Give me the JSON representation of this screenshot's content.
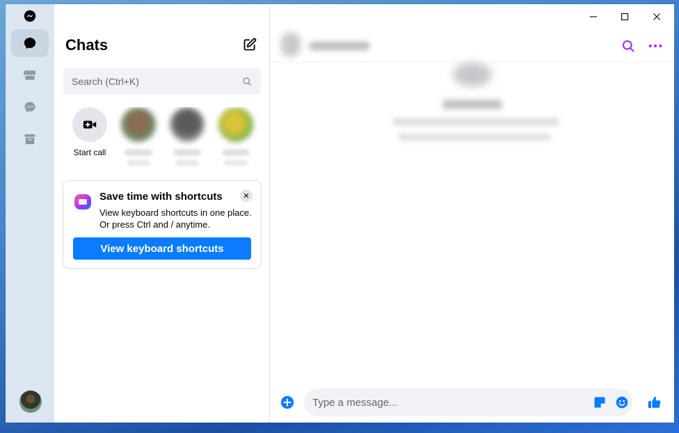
{
  "sidebar": {
    "title": "Chats",
    "search": {
      "placeholder": "Search (Ctrl+K)"
    },
    "stories": {
      "start_call_label": "Start call"
    }
  },
  "tip": {
    "title": "Save time with shortcuts",
    "body": "View keyboard shortcuts in one place. Or press Ctrl and / anytime.",
    "button_label": "View keyboard shortcuts",
    "close_glyph": "✕"
  },
  "composer": {
    "placeholder": "Type a message..."
  },
  "colors": {
    "accent": "#0a7cff",
    "header_icons": "#a033ff",
    "rail_bg": "#dbe6f1"
  },
  "icons": [
    "messenger-logo-icon",
    "chat-bubble-icon",
    "marketplace-icon",
    "message-requests-icon",
    "archive-icon",
    "compose-icon",
    "search-icon",
    "video-call-icon",
    "close-icon",
    "more-icon",
    "add-icon",
    "sticker-icon",
    "emoji-icon",
    "thumbs-up-icon",
    "minimize-icon",
    "maximize-icon"
  ]
}
